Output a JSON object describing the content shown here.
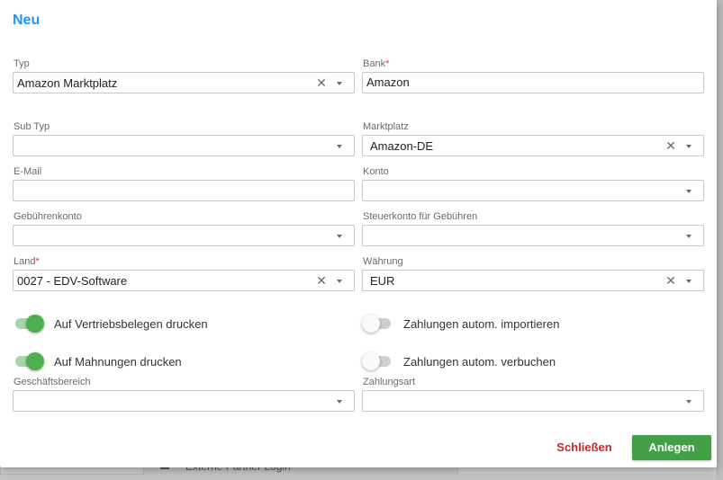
{
  "dialog": {
    "title": "Neu",
    "fields": {
      "typ": {
        "label": "Typ",
        "value": "Amazon Marktplatz"
      },
      "bank": {
        "label": "Bank",
        "required_mark": "*",
        "value": "Amazon"
      },
      "sub_typ": {
        "label": "Sub Typ",
        "value": ""
      },
      "marktplatz": {
        "label": "Marktplatz",
        "value": "Amazon-DE"
      },
      "email": {
        "label": "E-Mail",
        "value": ""
      },
      "konto": {
        "label": "Konto",
        "value": ""
      },
      "gebuehrenkonto": {
        "label": "Gebührenkonto",
        "value": ""
      },
      "steuerkonto": {
        "label": "Steuerkonto für Gebühren",
        "value": ""
      },
      "land": {
        "label": "Land",
        "required_mark": "*",
        "value": "0027 - EDV-Software"
      },
      "waehrung": {
        "label": "Währung",
        "value": "EUR"
      },
      "geschaeftsbereich": {
        "label": "Geschäftsbereich",
        "value": ""
      },
      "zahlungsart": {
        "label": "Zahlungsart",
        "value": ""
      }
    },
    "toggles": {
      "vertriebsbelege": {
        "label": "Auf Vertriebsbelegen drucken",
        "on": true
      },
      "mahnungen": {
        "label": "Auf Mahnungen drucken",
        "on": true
      },
      "zahlungen_import": {
        "label": "Zahlungen autom. importieren",
        "on": false
      },
      "zahlungen_verbuchen": {
        "label": "Zahlungen autom. verbuchen",
        "on": false
      }
    },
    "buttons": {
      "close": "Schließen",
      "create": "Anlegen"
    },
    "icons": {
      "clear": "close-icon",
      "dropdown": "chevron-down-icon"
    }
  },
  "background": {
    "row_text": "Externe Partner Login"
  },
  "colors": {
    "title": "#2196f3",
    "required": "#e53935",
    "toggle_on": "#4caf50",
    "close_button": "#c62828",
    "create_button": "#43a047"
  }
}
